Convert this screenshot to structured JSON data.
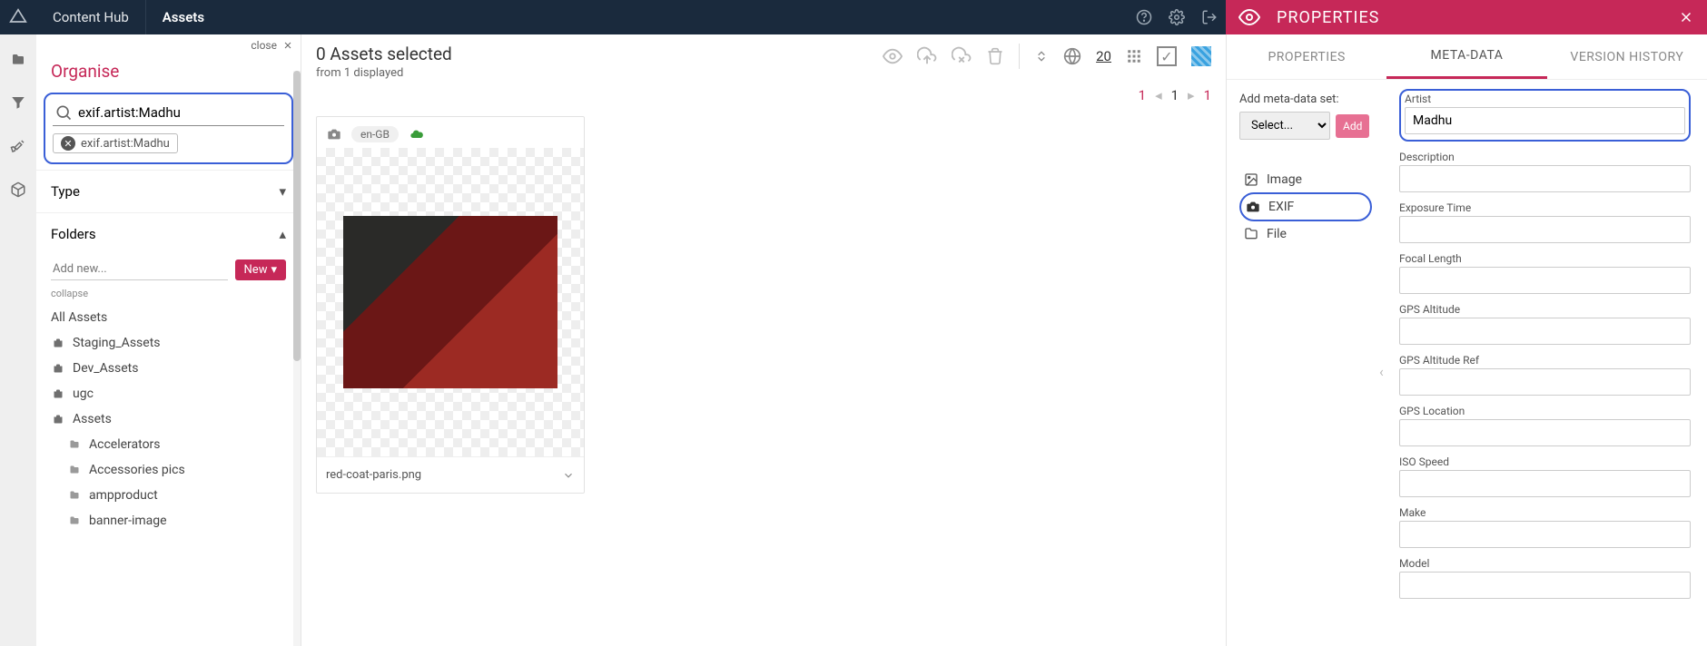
{
  "topbar": {
    "brand": "Content Hub",
    "section": "Assets"
  },
  "properties_header": {
    "title": "PROPERTIES"
  },
  "organise": {
    "title": "Organise",
    "close": "close",
    "search_value": "exif.artist:Madhu",
    "chip_value": "exif.artist:Madhu",
    "type_label": "Type",
    "folders_label": "Folders",
    "add_placeholder": "Add new...",
    "new_btn": "New",
    "collapse": "collapse",
    "folders": [
      {
        "label": "All Assets",
        "kind": "text"
      },
      {
        "label": "Staging_Assets",
        "kind": "case"
      },
      {
        "label": "Dev_Assets",
        "kind": "case"
      },
      {
        "label": "ugc",
        "kind": "case"
      },
      {
        "label": "Assets",
        "kind": "case"
      },
      {
        "label": "Accelerators",
        "kind": "sub"
      },
      {
        "label": "Accessories pics",
        "kind": "sub"
      },
      {
        "label": "ampproduct",
        "kind": "sub"
      },
      {
        "label": "banner-image",
        "kind": "sub"
      }
    ]
  },
  "center": {
    "selected_title": "0 Assets selected",
    "displayed": "from 1 displayed",
    "page_size": "20",
    "pager": {
      "first": "1",
      "current": "1",
      "last": "1"
    },
    "card": {
      "lang": "en-GB",
      "filename": "red-coat-paris.png"
    }
  },
  "right": {
    "tabs": {
      "properties": "PROPERTIES",
      "metadata": "META-DATA",
      "version": "VERSION HISTORY"
    },
    "add_set": {
      "label": "Add meta-data set:",
      "select_placeholder": "Select...",
      "add": "Add"
    },
    "categories": [
      {
        "label": "Image",
        "icon": "image"
      },
      {
        "label": "EXIF",
        "icon": "camera",
        "active": true
      },
      {
        "label": "File",
        "icon": "folder"
      }
    ],
    "fields": {
      "artist": {
        "label": "Artist",
        "value": "Madhu"
      },
      "description": {
        "label": "Description",
        "value": ""
      },
      "exposure_time": {
        "label": "Exposure Time",
        "value": ""
      },
      "focal_length": {
        "label": "Focal Length",
        "value": ""
      },
      "gps_altitude": {
        "label": "GPS Altitude",
        "value": ""
      },
      "gps_altitude_ref": {
        "label": "GPS Altitude Ref",
        "value": ""
      },
      "gps_location": {
        "label": "GPS Location",
        "value": ""
      },
      "iso_speed": {
        "label": "ISO Speed",
        "value": ""
      },
      "make": {
        "label": "Make",
        "value": ""
      },
      "model": {
        "label": "Model",
        "value": ""
      }
    }
  }
}
